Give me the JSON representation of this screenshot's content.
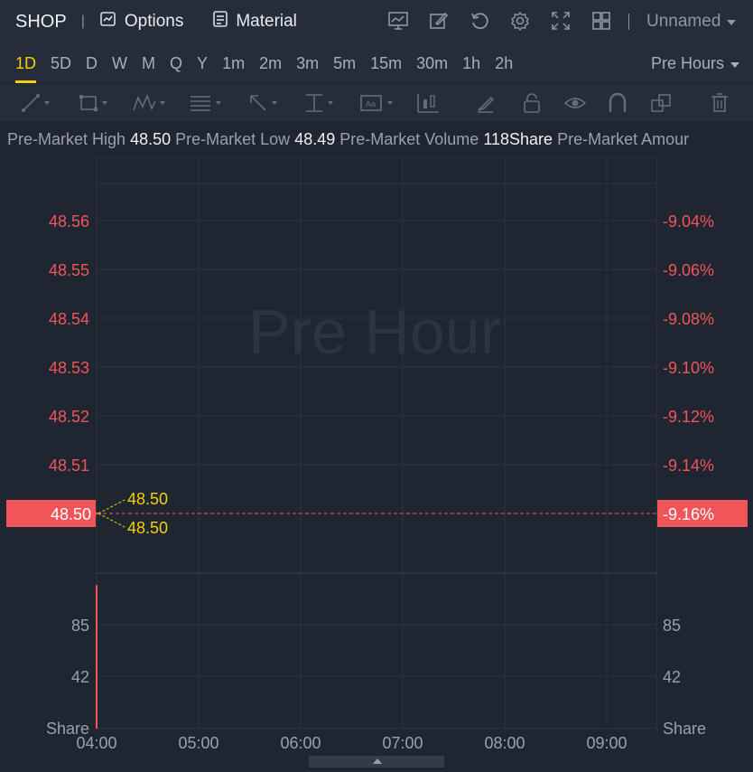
{
  "header": {
    "symbol": "SHOP",
    "options_label": "Options",
    "material_label": "Material",
    "layout_name": "Unnamed",
    "icons": [
      "chart-settings-icon",
      "draw-icon",
      "refresh-icon",
      "gear-icon",
      "fullscreen-icon",
      "grid-layout-icon"
    ]
  },
  "timeframes": {
    "items": [
      "1D",
      "5D",
      "D",
      "W",
      "M",
      "Q",
      "Y",
      "1m",
      "2m",
      "3m",
      "5m",
      "15m",
      "30m",
      "1h",
      "2h"
    ],
    "active": "1D",
    "session_label": "Pre Hours"
  },
  "drawing_tools": [
    "line-tool-icon",
    "rectangle-tool-icon",
    "pattern-tool-icon",
    "fib-tool-icon",
    "arrow-tool-icon",
    "measure-tool-icon",
    "text-tool-icon",
    "candle-tool-icon",
    "brush-icon",
    "lock-icon",
    "eye-icon",
    "magnet-icon",
    "copy-icon",
    "trash-icon"
  ],
  "info": {
    "high_label": "Pre-Market High",
    "high_value": "48.50",
    "low_label": "Pre-Market Low",
    "low_value": "48.49",
    "volume_label": "Pre-Market Volume",
    "volume_value": "118Share",
    "amount_label": "Pre-Market Amour"
  },
  "chart": {
    "watermark": "Pre Hour",
    "price_ticks_left": [
      "48.56",
      "48.55",
      "48.54",
      "48.53",
      "48.52",
      "48.51",
      "48.50"
    ],
    "price_ticks_right": [
      "-9.04%",
      "-9.06%",
      "-9.08%",
      "-9.10%",
      "-9.12%",
      "-9.14%",
      "-9.16%"
    ],
    "current_price": "48.50",
    "current_pct": "-9.16%",
    "annotation_high": "48.50",
    "annotation_low": "48.50",
    "volume_ticks_left": [
      "85",
      "42"
    ],
    "volume_ticks_right": [
      "85",
      "42"
    ],
    "volume_unit": "Share",
    "time_ticks": [
      "04:00",
      "05:00",
      "06:00",
      "07:00",
      "08:00",
      "09:00"
    ],
    "colors": {
      "down": "#f0555a",
      "accent": "#f5d000",
      "grid": "#2c3440"
    }
  },
  "chart_data": {
    "type": "line",
    "x": [
      "04:00"
    ],
    "series": [
      {
        "values": [
          48.5
        ]
      }
    ],
    "volume": [
      118
    ],
    "ylim": [
      48.495,
      48.565
    ],
    "xlim": [
      "04:00",
      "09:30"
    ],
    "grid": true
  }
}
